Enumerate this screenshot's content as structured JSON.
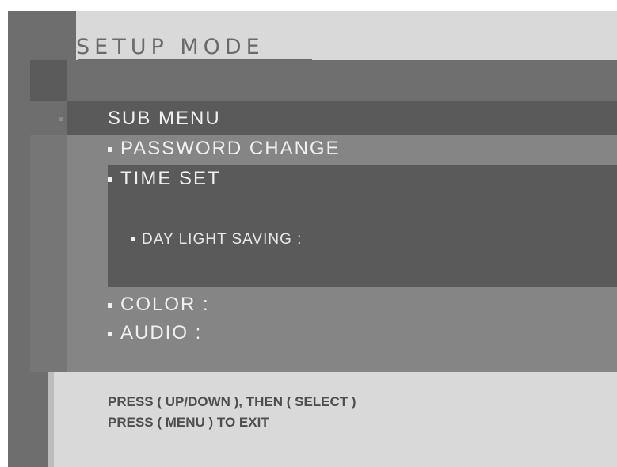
{
  "screen": {
    "title": "SETUP MODE",
    "submenu_label": "SUB MENU",
    "items": [
      {
        "label": "PASSWORD CHANGE"
      },
      {
        "label": "TIME SET"
      },
      {
        "label": "DAY LIGHT SAVING :"
      },
      {
        "label": "COLOR :"
      },
      {
        "label": "AUDIO :"
      }
    ],
    "help_lines": [
      "PRESS ( UP/DOWN ), THEN ( SELECT )",
      "PRESS ( MENU ) TO EXIT"
    ]
  }
}
